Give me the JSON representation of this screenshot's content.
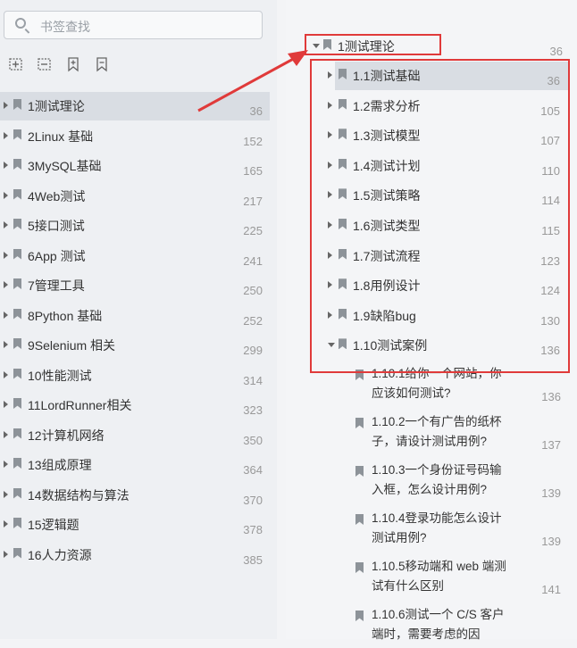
{
  "search": {
    "placeholder": "书签查找"
  },
  "toolbar": [
    "expand-all-icon",
    "collapse-all-icon",
    "add-bookmark-icon",
    "bookmark-icon"
  ],
  "left_items": [
    {
      "label": "1测试理论",
      "page": "36"
    },
    {
      "label": "2Linux 基础",
      "page": "152"
    },
    {
      "label": "3MySQL基础",
      "page": "165"
    },
    {
      "label": "4Web测试",
      "page": "217"
    },
    {
      "label": "5接口测试",
      "page": "225"
    },
    {
      "label": "6App 测试",
      "page": "241"
    },
    {
      "label": "7管理工具",
      "page": "250"
    },
    {
      "label": "8Python 基础",
      "page": "252"
    },
    {
      "label": "9Selenium 相关",
      "page": "299"
    },
    {
      "label": "10性能测试",
      "page": "314"
    },
    {
      "label": "11LordRunner相关",
      "page": "323"
    },
    {
      "label": "12计算机网络",
      "page": "350"
    },
    {
      "label": "13组成原理",
      "page": "364"
    },
    {
      "label": "14数据结构与算法",
      "page": "370"
    },
    {
      "label": "15逻辑题",
      "page": "378"
    },
    {
      "label": "16人力资源",
      "page": "385"
    }
  ],
  "right_root": {
    "label": "1测试理论",
    "page": "36"
  },
  "right_items": [
    {
      "label": "1.1测试基础",
      "page": "36"
    },
    {
      "label": "1.2需求分析",
      "page": "105"
    },
    {
      "label": "1.3测试模型",
      "page": "107"
    },
    {
      "label": "1.4测试计划",
      "page": "110"
    },
    {
      "label": "1.5测试策略",
      "page": "114"
    },
    {
      "label": "1.6测试类型",
      "page": "115"
    },
    {
      "label": "1.7测试流程",
      "page": "123"
    },
    {
      "label": "1.8用例设计",
      "page": "124"
    },
    {
      "label": "1.9缺陷bug",
      "page": "130"
    },
    {
      "label": "1.10测试案例",
      "page": "136"
    }
  ],
  "right_sub": [
    {
      "label": "1.10.1给你一个网站，你应该如何测试?",
      "page": "136"
    },
    {
      "label": "1.10.2一个有广告的纸杯子，请设计测试用例?",
      "page": "137"
    },
    {
      "label": "1.10.3一个身份证号码输入框，怎么设计用例?",
      "page": "139"
    },
    {
      "label": "1.10.4登录功能怎么设计测试用例?",
      "page": "139"
    },
    {
      "label": "1.10.5移动端和 web 端测试有什么区别",
      "page": "141"
    },
    {
      "label": "1.10.6测试一个 C/S 客户端时，需要考虑的因",
      "page": ""
    }
  ]
}
